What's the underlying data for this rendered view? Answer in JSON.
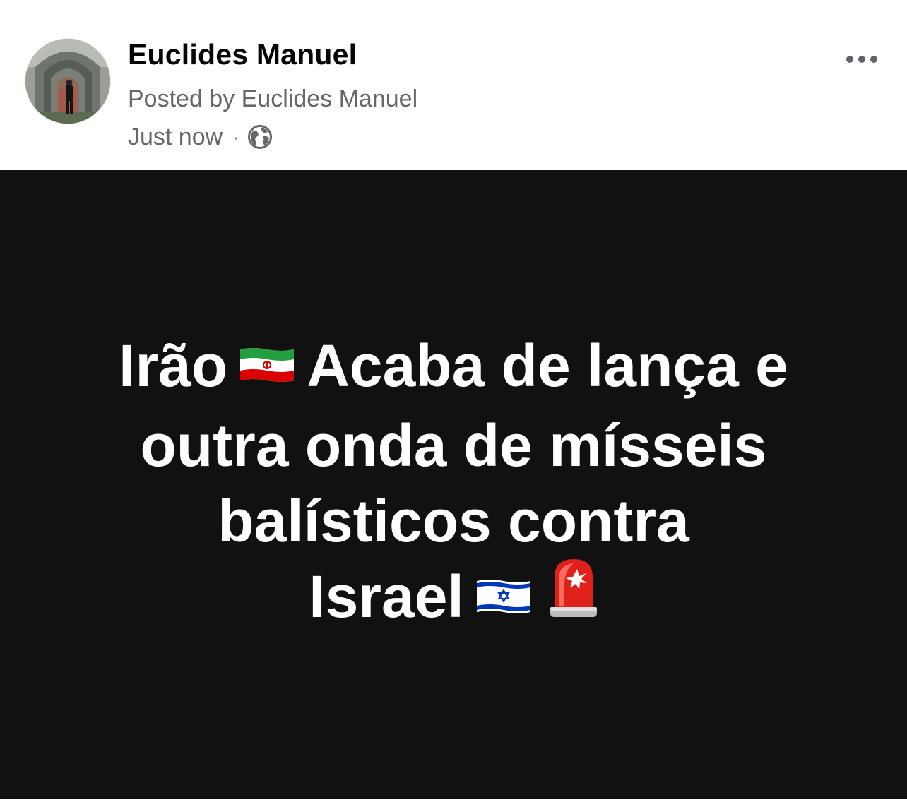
{
  "post": {
    "author": "Euclides Manuel",
    "posted_by": "Posted by Euclides Manuel",
    "timestamp": "Just now",
    "separator": "·",
    "privacy_icon": "globe-icon",
    "more_icon": "more-options-icon"
  },
  "image": {
    "line1_a": "Irão",
    "line1_b": "Acaba de lança e",
    "line2": "outra onda de mísseis",
    "line3": "balísticos contra",
    "line4": "Israel",
    "emoji": [
      "iran-flag-icon",
      "israel-flag-icon",
      "police-siren-icon"
    ]
  },
  "colors": {
    "image_background": "#111111",
    "text_primary": "#050505",
    "text_secondary": "#65676b"
  }
}
